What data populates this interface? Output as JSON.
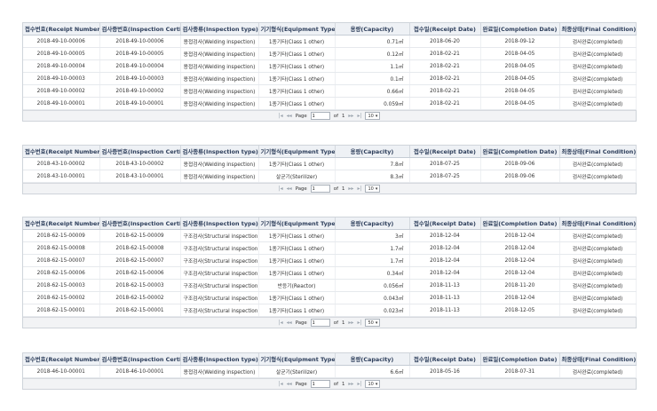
{
  "headers": [
    "접수번호(Receipt Number)",
    "검사증번호(Inspection Certific",
    "검사종류(Inspection type)",
    "기기형식(Equipment Type)",
    "용량(Capacity)",
    "접수일(Receipt Date)",
    "완료일(Completion Date)",
    "최종상태(Final Condition)"
  ],
  "pager": {
    "page_label": "Page",
    "of_label": "of",
    "first": "|◂",
    "prev": "◂◂",
    "next": "▸▸",
    "last": "▸|"
  },
  "grids": [
    {
      "rows": [
        [
          "2018-49-10-00006",
          "2018-49-10-00006",
          "용접검사(Welding inspection)",
          "1종기타(Class 1 other)",
          "0.71㎥",
          "2018-06-20",
          "2018-09-12",
          "검사완료(completed)"
        ],
        [
          "2018-49-10-00005",
          "2018-49-10-00005",
          "용접검사(Welding inspection)",
          "1종기타(Class 1 other)",
          "0.12㎥",
          "2018-02-21",
          "2018-04-05",
          "검사완료(completed)"
        ],
        [
          "2018-49-10-00004",
          "2018-49-10-00004",
          "용접검사(Welding inspection)",
          "1종기타(Class 1 other)",
          "1.1㎥",
          "2018-02-21",
          "2018-04-05",
          "검사완료(completed)"
        ],
        [
          "2018-49-10-00003",
          "2018-49-10-00003",
          "용접검사(Welding inspection)",
          "1종기타(Class 1 other)",
          "0.1㎥",
          "2018-02-21",
          "2018-04-05",
          "검사완료(completed)"
        ],
        [
          "2018-49-10-00002",
          "2018-49-10-00002",
          "용접검사(Welding inspection)",
          "1종기타(Class 1 other)",
          "0.66㎥",
          "2018-02-21",
          "2018-04-05",
          "검사완료(completed)"
        ],
        [
          "2018-49-10-00001",
          "2018-49-10-00001",
          "용접검사(Welding inspection)",
          "1종기타(Class 1 other)",
          "0.059㎥",
          "2018-02-21",
          "2018-04-05",
          "검사완료(completed)"
        ]
      ],
      "page_input": "1",
      "total_pages": "1",
      "page_size": "10"
    },
    {
      "rows": [
        [
          "2018-43-10-00002",
          "2018-43-10-00002",
          "용접검사(Welding inspection)",
          "1종기타(Class 1 other)",
          "7.8㎥",
          "2018-07-25",
          "2018-09-06",
          "검사완료(completed)"
        ],
        [
          "2018-43-10-00001",
          "2018-43-10-00001",
          "용접검사(Welding inspection)",
          "살균기(Sterilizer)",
          "8.3㎥",
          "2018-07-25",
          "2018-09-06",
          "검사완료(completed)"
        ]
      ],
      "page_input": "1",
      "total_pages": "1",
      "page_size": "10"
    },
    {
      "rows": [
        [
          "2018-62-15-00009",
          "2018-62-15-00009",
          "구조검사(Structural inspection)",
          "1종기타(Class 1 other)",
          "3㎥",
          "2018-12-04",
          "2018-12-04",
          "검사완료(completed)"
        ],
        [
          "2018-62-15-00008",
          "2018-62-15-00008",
          "구조검사(Structural inspection)",
          "1종기타(Class 1 other)",
          "1.7㎥",
          "2018-12-04",
          "2018-12-04",
          "검사완료(completed)"
        ],
        [
          "2018-62-15-00007",
          "2018-62-15-00007",
          "구조검사(Structural inspection)",
          "1종기타(Class 1 other)",
          "1.7㎥",
          "2018-12-04",
          "2018-12-04",
          "검사완료(completed)"
        ],
        [
          "2018-62-15-00006",
          "2018-62-15-00006",
          "구조검사(Structural inspection)",
          "1종기타(Class 1 other)",
          "0.34㎥",
          "2018-12-04",
          "2018-12-04",
          "검사완료(completed)"
        ],
        [
          "2018-62-15-00003",
          "2018-62-15-00003",
          "구조검사(Structural inspection)",
          "반응기(Reactor)",
          "0.056㎥",
          "2018-11-13",
          "2018-11-20",
          "검사완료(completed)"
        ],
        [
          "2018-62-15-00002",
          "2018-62-15-00002",
          "구조검사(Structural inspection)",
          "1종기타(Class 1 other)",
          "0.043㎥",
          "2018-11-13",
          "2018-12-04",
          "검사완료(completed)"
        ],
        [
          "2018-62-15-00001",
          "2018-62-15-00001",
          "구조검사(Structural inspection)",
          "1종기타(Class 1 other)",
          "0.023㎥",
          "2018-11-13",
          "2018-12-05",
          "검사완료(completed)"
        ]
      ],
      "page_input": "1",
      "total_pages": "1",
      "page_size": "50"
    },
    {
      "rows": [
        [
          "2018-46-10-00001",
          "2018-46-10-00001",
          "용접검사(Welding inspection)",
          "살균기(Sterilizer)",
          "6.6㎥",
          "2018-05-16",
          "2018-07-31",
          "검사완료(completed)"
        ]
      ],
      "page_input": "1",
      "total_pages": "1",
      "page_size": "10"
    }
  ]
}
